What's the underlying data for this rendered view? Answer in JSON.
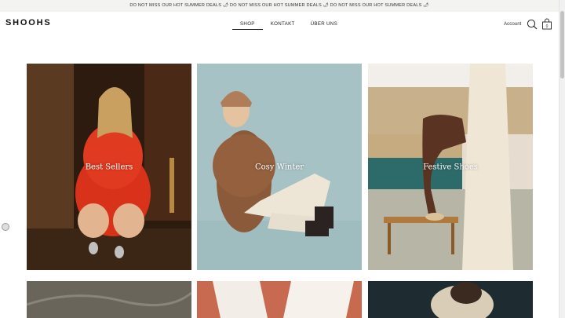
{
  "announcement": {
    "text": "DO NOT MISS OUR HOT SUMMER DEALS 🌶 DO NOT MISS OUR HOT SUMMER DEALS 🌶 DO NOT MISS OUR HOT SUMMER DEALS 🌶"
  },
  "header": {
    "logo": "SHOOHS",
    "nav": [
      {
        "label": "SHOP"
      },
      {
        "label": "KONTAKT"
      },
      {
        "label": "ÜBER UNS"
      }
    ],
    "account_label": "Account",
    "cart_count": "0"
  },
  "tiles": [
    {
      "label": "Best Sellers"
    },
    {
      "label": "Cosy Winter"
    },
    {
      "label": "Festive Shoes"
    }
  ],
  "icons": {
    "search": "search-icon",
    "cart": "cart-icon",
    "cookie": "cookie-icon"
  }
}
